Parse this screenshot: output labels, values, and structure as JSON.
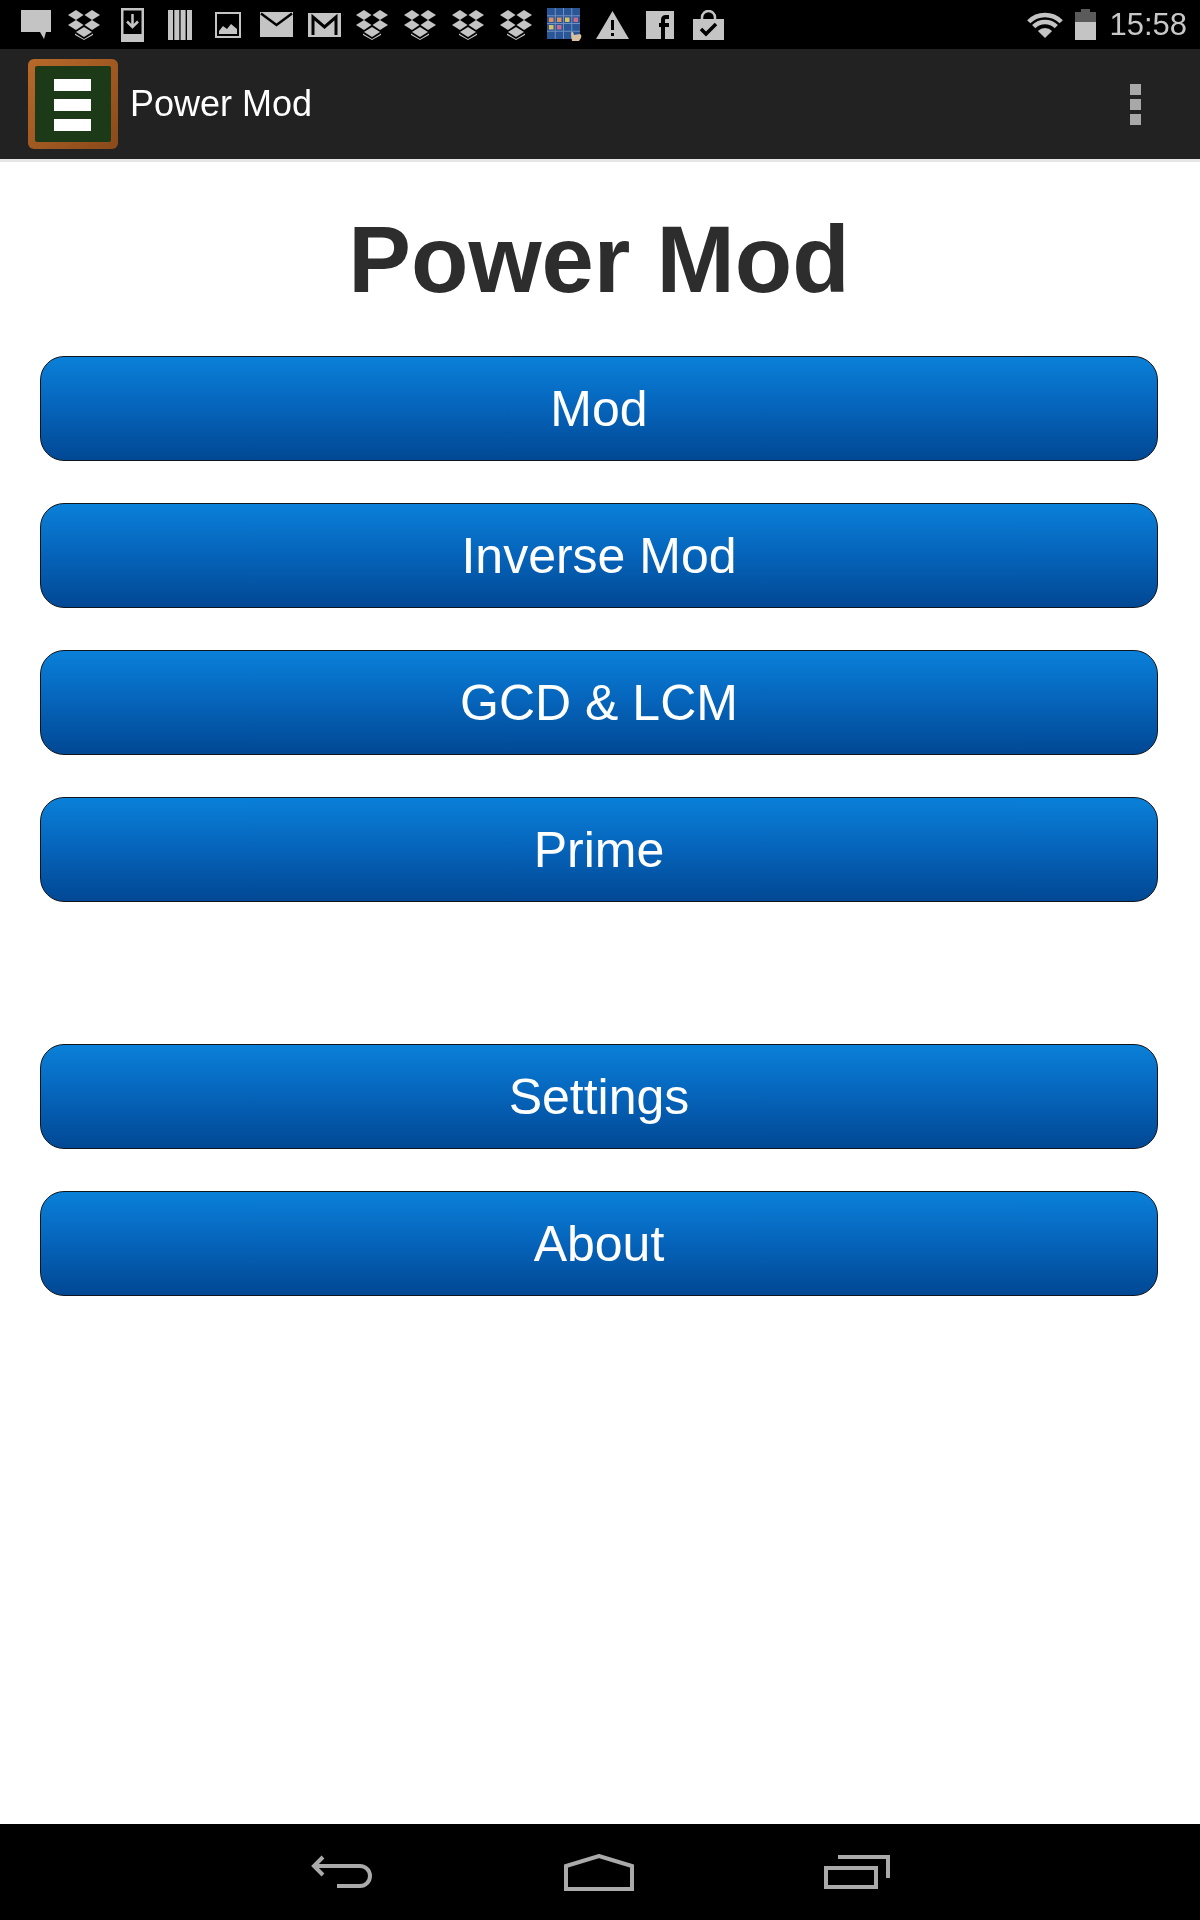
{
  "status_bar": {
    "time": "15:58"
  },
  "app_bar": {
    "title": "Power Mod"
  },
  "heading": "Power Mod",
  "button_groups": [
    {
      "buttons": [
        {
          "label": "Mod"
        },
        {
          "label": "Inverse Mod"
        },
        {
          "label": "GCD & LCM"
        },
        {
          "label": "Prime"
        }
      ]
    },
    {
      "buttons": [
        {
          "label": "Settings"
        },
        {
          "label": "About"
        }
      ]
    }
  ]
}
